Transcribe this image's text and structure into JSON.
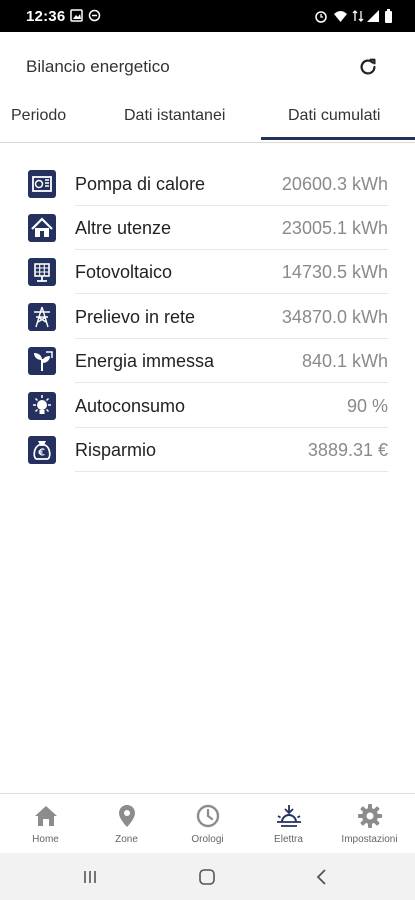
{
  "status": {
    "time": "12:36"
  },
  "header": {
    "title": "Bilancio energetico"
  },
  "tabs": [
    {
      "label": "Periodo",
      "active": false
    },
    {
      "label": "Dati istantanei",
      "active": false
    },
    {
      "label": "Dati cumulati",
      "active": true
    }
  ],
  "rows": [
    {
      "label": "Pompa di calore",
      "value": "20600.3 kWh",
      "icon": "heat-pump-icon"
    },
    {
      "label": "Altre utenze",
      "value": "23005.1 kWh",
      "icon": "house-icon"
    },
    {
      "label": "Fotovoltaico",
      "value": "14730.5 kWh",
      "icon": "solar-panel-icon"
    },
    {
      "label": "Prelievo in rete",
      "value": "34870.0 kWh",
      "icon": "power-pylon-icon"
    },
    {
      "label": "Energia immessa",
      "value": "840.1 kWh",
      "icon": "energy-export-icon"
    },
    {
      "label": "Autoconsumo",
      "value": "90 %",
      "icon": "lightbulb-icon"
    },
    {
      "label": "Risparmio",
      "value": "3889.31 €",
      "icon": "money-bag-icon"
    }
  ],
  "bottom_nav": [
    {
      "label": "Home",
      "icon": "home-icon",
      "active": false
    },
    {
      "label": "Zone",
      "icon": "location-pin-icon",
      "active": false
    },
    {
      "label": "Orologi",
      "icon": "clock-icon",
      "active": false
    },
    {
      "label": "Elettra",
      "icon": "sunrise-icon",
      "active": true
    },
    {
      "label": "Impostazioni",
      "icon": "gear-icon",
      "active": false
    }
  ],
  "colors": {
    "accent": "#24305e",
    "inactive_nav": "#8c8c8c",
    "value_text": "#8a8a8a"
  }
}
